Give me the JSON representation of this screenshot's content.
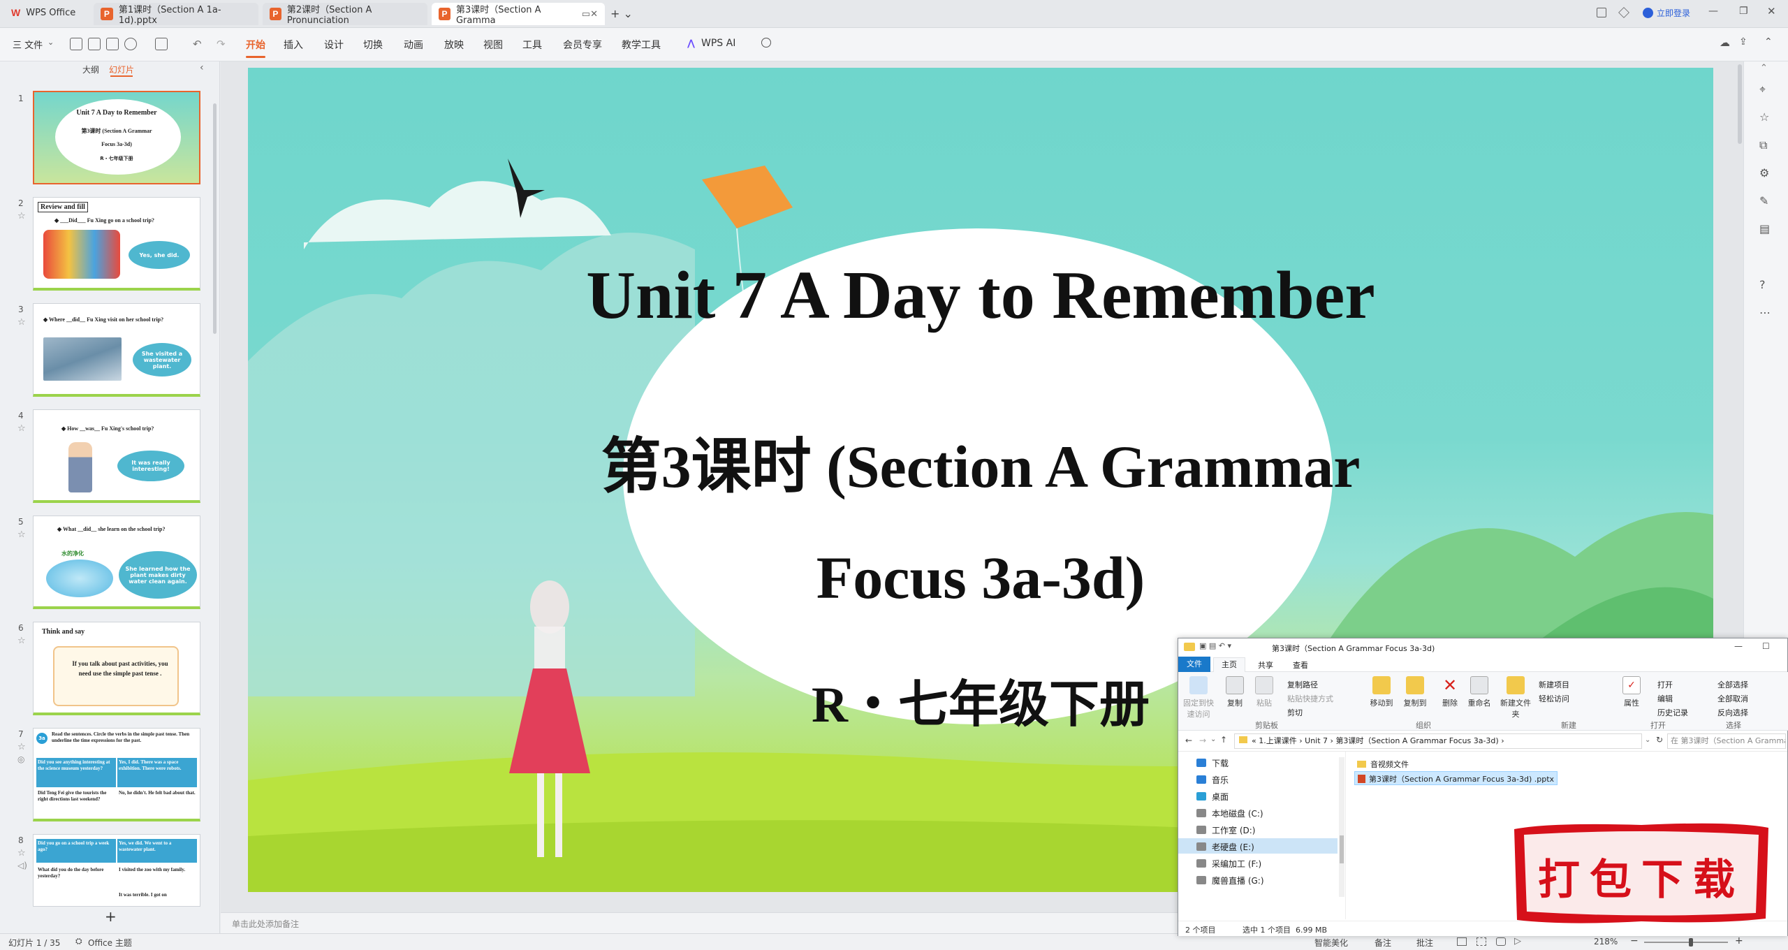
{
  "app": {
    "name": "WPS Office"
  },
  "tabs": [
    {
      "label": "第1课时（Section A 1a-1d).pptx"
    },
    {
      "label": "第2课时（Section A Pronunciation"
    },
    {
      "label": "第3课时（Section A Gramma"
    }
  ],
  "titlebar": {
    "login_label": "立即登录"
  },
  "ribbon": {
    "file_label": "三 文件",
    "menus": [
      "开始",
      "插入",
      "设计",
      "切换",
      "动画",
      "放映",
      "视图",
      "工具",
      "会员专享",
      "教学工具",
      "WPS AI"
    ]
  },
  "leftpane": {
    "tab_outline": "大纲",
    "tab_slides": "幻灯片",
    "add_label": "+",
    "thumbs": [
      {
        "num": "1",
        "line1": "Unit 7 A Day to Remember",
        "line2": "第3课时 (Section A Grammar",
        "line3": "Focus 3a-3d)",
        "line4": "R・七年级下册"
      },
      {
        "num": "2",
        "title": "Review and fill",
        "q": "◆ ___Did___ Fu Xing go on a school trip?",
        "bubble": "Yes, she did."
      },
      {
        "num": "3",
        "q": "◆ Where __did__ Fu Xing visit on her school trip?",
        "bubble": "She visited a wastewater plant."
      },
      {
        "num": "4",
        "q": "◆ How __was__ Fu Xing's school trip?",
        "bubble": "It was really interesting!"
      },
      {
        "num": "5",
        "q": "◆ What __did__ she learn on the school trip?",
        "tag": "水的净化",
        "bubble": "She learned how the plant makes dirty water clean again."
      },
      {
        "num": "6",
        "title": "Think and say",
        "body": "If you talk about past activities, you need use the simple past tense ."
      },
      {
        "num": "7",
        "badge": "3a",
        "intro": "Read the sentences. Circle the verbs in the simple past tense. Then underline the time expressions for the past.",
        "c1": "Did you see anything interesting at the science museum yesterday?",
        "c2": "Yes, I did. There was a space exhibition. There were robots.",
        "c3": "Did Teng Fei give the tourists the right directions last weekend?",
        "c4": "No, he didn't. He felt bad about that."
      },
      {
        "num": "8",
        "c1": "Did you go on a school trip a week ago?",
        "c2": "Yes, we did. We went to a wastewater plant.",
        "c3": "What did you do the day before yesterday?",
        "c4": "I visited the zoo with my family.",
        "c5": "It was terrible. I got on"
      }
    ]
  },
  "slide": {
    "title": "Unit 7 A Day to Remember",
    "subtitle1": "第3课时 (Section A Grammar",
    "subtitle2": "Focus 3a-3d)",
    "grade": "R・七年级下册"
  },
  "notes": {
    "placeholder": "单击此处添加备注"
  },
  "status": {
    "slide_counter": "幻灯片 1 / 35",
    "theme": "Office 主题",
    "beautify": "智能美化",
    "notes_btn": "备注",
    "comment_btn": "批注",
    "zoom": "218%"
  },
  "explorer": {
    "title": "第3课时（Section A Grammar Focus 3a-3d)",
    "tabs": [
      "文件",
      "主页",
      "共享",
      "查看"
    ],
    "ribbon": {
      "pin": "固定到快速访问",
      "copy": "复制",
      "paste": "粘贴",
      "copy_path": "复制路径",
      "paste_shortcut": "粘贴快捷方式",
      "cut": "剪切",
      "clipboard_group": "剪贴板",
      "move_to": "移动到",
      "copy_to": "复制到",
      "delete": "删除",
      "rename": "重命名",
      "organize_group": "组织",
      "new_folder": "新建文件夹",
      "new_item": "新建项目",
      "easy_access": "轻松访问",
      "new_group": "新建",
      "properties": "属性",
      "open": "打开",
      "edit": "编辑",
      "history": "历史记录",
      "open_group": "打开",
      "select_all": "全部选择",
      "select_none": "全部取消",
      "invert": "反向选择",
      "select_group": "选择"
    },
    "path": [
      "«",
      "1.上课课件",
      "›",
      "Unit 7",
      "›",
      "第3课时（Section A Grammar Focus 3a-3d)",
      "›"
    ],
    "search_placeholder": "在 第3课时（Section A Grammar ...",
    "nav": [
      "下载",
      "音乐",
      "桌面",
      "本地磁盘 (C:)",
      "工作室 (D:)",
      "老硬盘 (E:)",
      "采编加工 (F:)",
      "魔兽直播 (G:)"
    ],
    "files": [
      "音视频文件",
      "第3课时（Section A Grammar Focus 3a-3d) .pptx"
    ],
    "status_count": "2 个项目",
    "status_selected": "选中 1 个项目  6.99 MB"
  },
  "promo": {
    "label": "打包下载"
  },
  "colors": {
    "accent": "#e8642d",
    "sky": "#6fd6cc",
    "grass": "#b7e35a",
    "promo_red": "#d6101a"
  }
}
